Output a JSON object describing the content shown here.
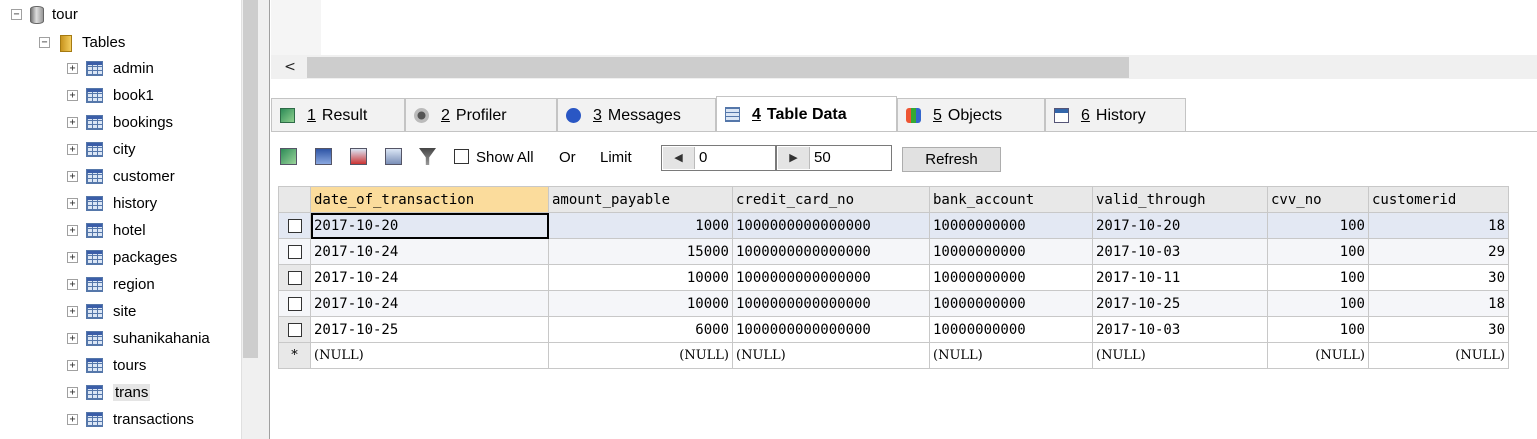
{
  "tree": {
    "database": "tour",
    "tables_folder": "Tables",
    "tables": [
      "admin",
      "book1",
      "bookings",
      "city",
      "customer",
      "history",
      "hotel",
      "packages",
      "region",
      "site",
      "suhanikahania",
      "tours",
      "trans",
      "transactions"
    ],
    "selected_table": "trans"
  },
  "tabs": [
    {
      "num": "1",
      "label": "Result"
    },
    {
      "num": "2",
      "label": "Profiler"
    },
    {
      "num": "3",
      "label": "Messages"
    },
    {
      "num": "4",
      "label": "Table Data"
    },
    {
      "num": "5",
      "label": "Objects"
    },
    {
      "num": "6",
      "label": "History"
    }
  ],
  "toolbar": {
    "show_all": "Show All",
    "or": "Or",
    "limit": "Limit",
    "limit_start": "0",
    "limit_count": "50",
    "refresh": "Refresh"
  },
  "grid": {
    "columns": [
      "date_of_transaction",
      "amount_payable",
      "credit_card_no",
      "bank_account",
      "valid_through",
      "cvv_no",
      "customerid"
    ],
    "rows": [
      [
        "2017-10-20",
        "1000",
        "1000000000000000",
        "10000000000",
        "2017-10-20",
        "100",
        "18"
      ],
      [
        "2017-10-24",
        "15000",
        "1000000000000000",
        "10000000000",
        "2017-10-03",
        "100",
        "29"
      ],
      [
        "2017-10-24",
        "10000",
        "1000000000000000",
        "10000000000",
        "2017-10-11",
        "100",
        "30"
      ],
      [
        "2017-10-24",
        "10000",
        "1000000000000000",
        "10000000000",
        "2017-10-25",
        "100",
        "18"
      ],
      [
        "2017-10-25",
        "6000",
        "1000000000000000",
        "10000000000",
        "2017-10-03",
        "100",
        "30"
      ]
    ],
    "new_row_marker": "*",
    "null_text": "(NULL)"
  },
  "colors": {
    "sorted_header": "#fbdc9c",
    "focus_row": "#e3e8f3"
  }
}
